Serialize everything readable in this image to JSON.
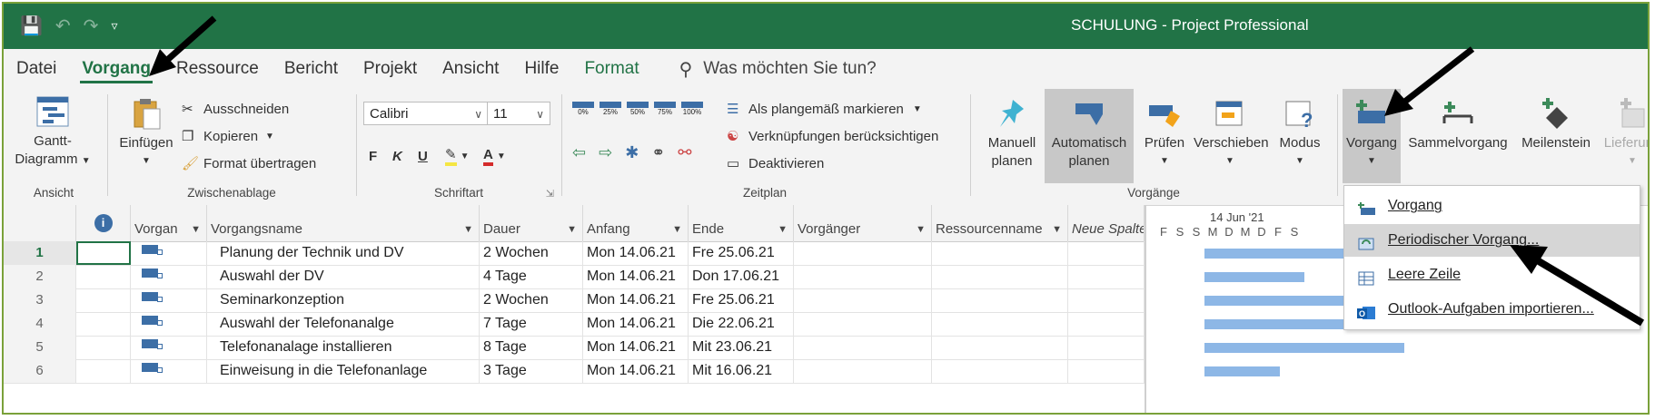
{
  "window": {
    "title": "SCHULUNG  -  Project Professional"
  },
  "menu": {
    "tabs": [
      "Datei",
      "Vorgang",
      "Ressource",
      "Bericht",
      "Projekt",
      "Ansicht",
      "Hilfe",
      "Format"
    ],
    "active": "Vorgang",
    "search_placeholder": "Was möchten Sie tun?"
  },
  "ribbon": {
    "ansicht": {
      "button": "Gantt-",
      "button2": "Diagramm",
      "label": "Ansicht"
    },
    "zwischenablage": {
      "paste": "Einfügen",
      "cut": "Ausschneiden",
      "copy": "Kopieren",
      "format": "Format übertragen",
      "label": "Zwischenablage"
    },
    "schriftart": {
      "font": "Calibri",
      "size": "11",
      "bold": "F",
      "italic": "K",
      "underline": "U",
      "label": "Schriftart"
    },
    "zeitplan": {
      "pcts": [
        "0%",
        "25%",
        "50%",
        "75%",
        "100%"
      ],
      "mark": "Als plangemäß markieren",
      "links": "Verknüpfungen berücksichtigen",
      "deactivate": "Deaktivieren",
      "label": "Zeitplan"
    },
    "vorgaenge": {
      "manual1": "Manuell",
      "manual2": "planen",
      "auto1": "Automatisch",
      "auto2": "planen",
      "check": "Prüfen",
      "move": "Verschieben",
      "mode": "Modus",
      "label": "Vorgänge"
    },
    "einfuegen": {
      "task": "Vorgang",
      "summary": "Sammelvorgang",
      "milestone": "Meilenstein",
      "deliverable": "Lieferung"
    }
  },
  "grid": {
    "headers": {
      "mode": "Vorgan",
      "name": "Vorgangsname",
      "duration": "Dauer",
      "start": "Anfang",
      "end": "Ende",
      "pred": "Vorgänger",
      "res": "Ressourcenname",
      "newcol": "Neue Spalte"
    },
    "rows": [
      {
        "n": "1",
        "name": "Planung der Technik und DV",
        "duration": "2 Wochen",
        "start": "Mon 14.06.21",
        "end": "Fre 25.06.21"
      },
      {
        "n": "2",
        "name": "Auswahl der DV",
        "duration": "4 Tage",
        "start": "Mon 14.06.21",
        "end": "Don 17.06.21"
      },
      {
        "n": "3",
        "name": "Seminarkonzeption",
        "duration": "2 Wochen",
        "start": "Mon 14.06.21",
        "end": "Fre 25.06.21"
      },
      {
        "n": "4",
        "name": "Auswahl der Telefonanalge",
        "duration": "7 Tage",
        "start": "Mon 14.06.21",
        "end": "Die 22.06.21"
      },
      {
        "n": "5",
        "name": "Telefonanalage installieren",
        "duration": "8 Tage",
        "start": "Mon 14.06.21",
        "end": "Mit 23.06.21"
      },
      {
        "n": "6",
        "name": "Einweisung in die Telefonanlage",
        "duration": "3 Tage",
        "start": "Mon 14.06.21",
        "end": "Mit 16.06.21"
      }
    ]
  },
  "gantt": {
    "week": "14 Jun '21",
    "days": [
      "F",
      "S",
      "S",
      "M",
      "D",
      "M",
      "D",
      "F",
      "S"
    ],
    "bar_days": [
      10,
      4,
      10,
      7,
      8,
      3
    ]
  },
  "dropdown": {
    "items": [
      "Vorgang",
      "Periodischer Vorgang...",
      "Leere Zeile",
      "Outlook-Aufgaben importieren..."
    ]
  },
  "colors": {
    "accent": "#217346",
    "bar": "#8db7e6",
    "task_icon": "#3c6ea6"
  }
}
